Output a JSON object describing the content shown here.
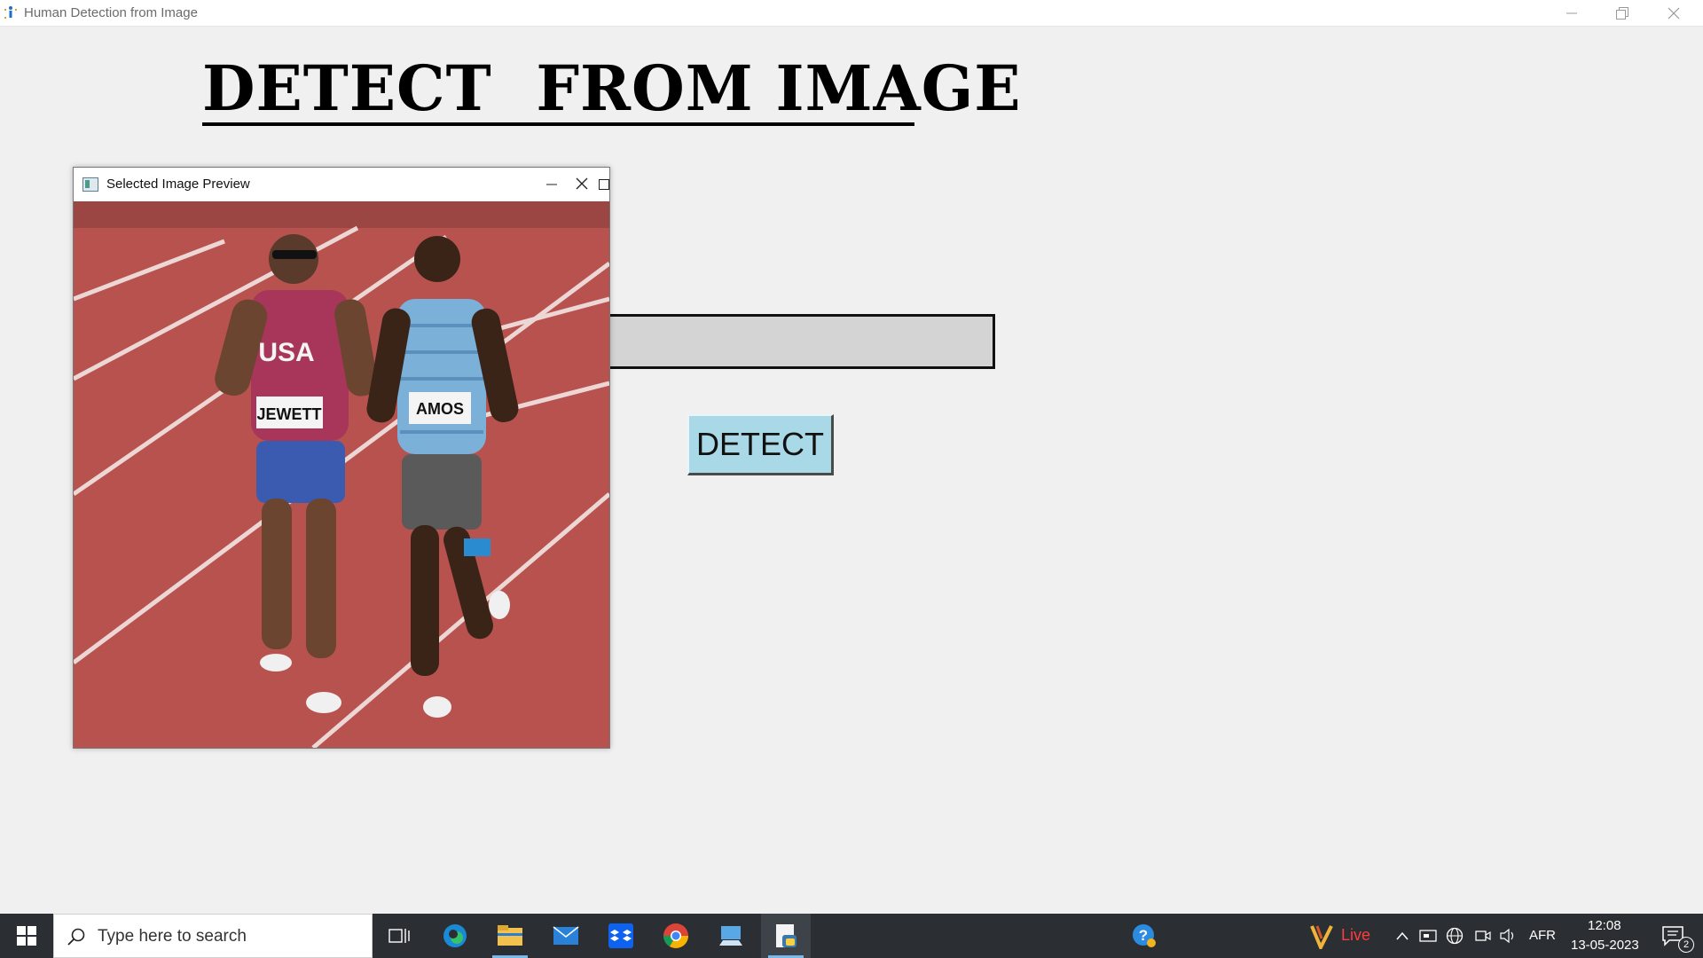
{
  "window": {
    "title": "Human Detection from Image"
  },
  "main": {
    "heading": "DETECT  FROM IMAGE",
    "path_value": "",
    "detect_label": "DETECT"
  },
  "preview": {
    "title": "Selected Image Preview",
    "bib_left": "JEWETT",
    "bib_right": "AMOS",
    "jersey_text": "USA"
  },
  "taskbar": {
    "search_placeholder": "Type here to search",
    "live_label": "Live",
    "language": "AFR",
    "time": "12:08",
    "date": "13-05-2023",
    "notification_count": "2",
    "apps": [
      "start-icon",
      "task-view-icon",
      "edge-icon",
      "file-explorer-icon",
      "mail-icon",
      "dropbox-icon",
      "chrome-icon",
      "remote-desktop-icon",
      "python-idle-icon"
    ]
  },
  "colors": {
    "background": "#f0f0f0",
    "detect_button": "#a9d8e6",
    "input_fill": "#d4d4d4",
    "taskbar": "#2b2f33",
    "track": "#b8524f"
  }
}
